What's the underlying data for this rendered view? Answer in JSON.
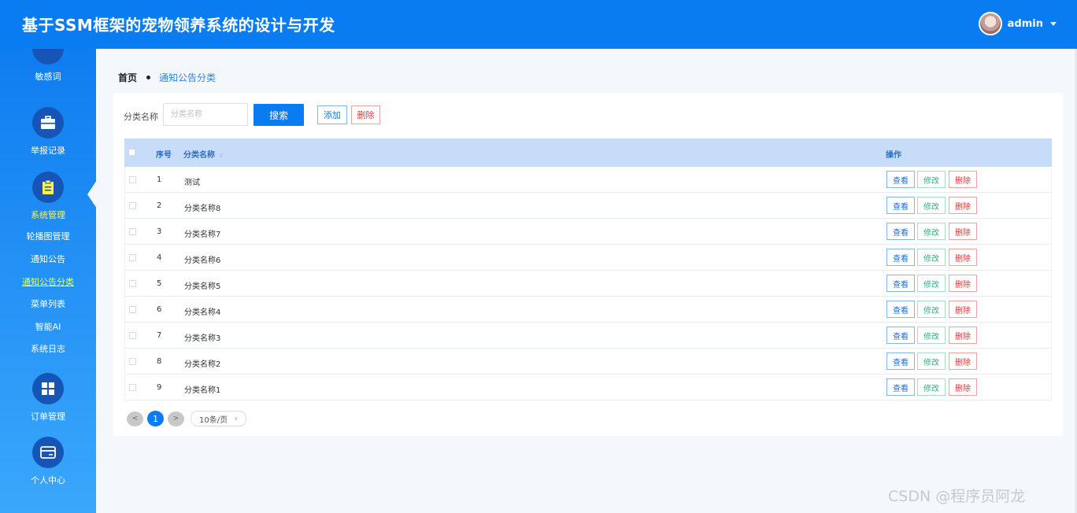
{
  "app": {
    "title": "基于SSM框架的宠物领养系统的设计与开发",
    "user": "admin"
  },
  "sidebar": {
    "items": [
      {
        "label": "敏感词",
        "icon": "list-icon"
      },
      {
        "label": "举报记录",
        "icon": "briefcase-icon"
      },
      {
        "label": "系统管理",
        "icon": "clipboard-icon",
        "active": true
      },
      {
        "label": "订单管理",
        "icon": "grid-icon"
      },
      {
        "label": "个人中心",
        "icon": "card-icon"
      }
    ],
    "system_submenu": [
      "轮播图管理",
      "通知公告",
      "通知公告分类",
      "菜单列表",
      "智能AI",
      "系统日志"
    ]
  },
  "breadcrumb": {
    "home": "首页",
    "current": "通知公告分类"
  },
  "filter": {
    "label": "分类名称",
    "placeholder": "分类名称",
    "search": "搜索",
    "add": "添加",
    "delete": "删除"
  },
  "table": {
    "headers": {
      "index": "序号",
      "name": "分类名称",
      "actions": "操作"
    },
    "rows": [
      {
        "index": "1",
        "name": "测试"
      },
      {
        "index": "2",
        "name": "分类名称8"
      },
      {
        "index": "3",
        "name": "分类名称7"
      },
      {
        "index": "4",
        "name": "分类名称6"
      },
      {
        "index": "5",
        "name": "分类名称5"
      },
      {
        "index": "6",
        "name": "分类名称4"
      },
      {
        "index": "7",
        "name": "分类名称3"
      },
      {
        "index": "8",
        "name": "分类名称2"
      },
      {
        "index": "9",
        "name": "分类名称1"
      }
    ],
    "actions": {
      "view": "查看",
      "edit": "修改",
      "delete": "删除"
    }
  },
  "pagination": {
    "prev": "<",
    "current": "1",
    "next": ">",
    "page_size": "10条/页"
  },
  "watermark": "CSDN @程序员阿龙",
  "colors": {
    "primary": "#0a7cf2",
    "sidebar_active_text": "#fff44d",
    "danger": "#e23a3a",
    "success": "#34ad80"
  }
}
